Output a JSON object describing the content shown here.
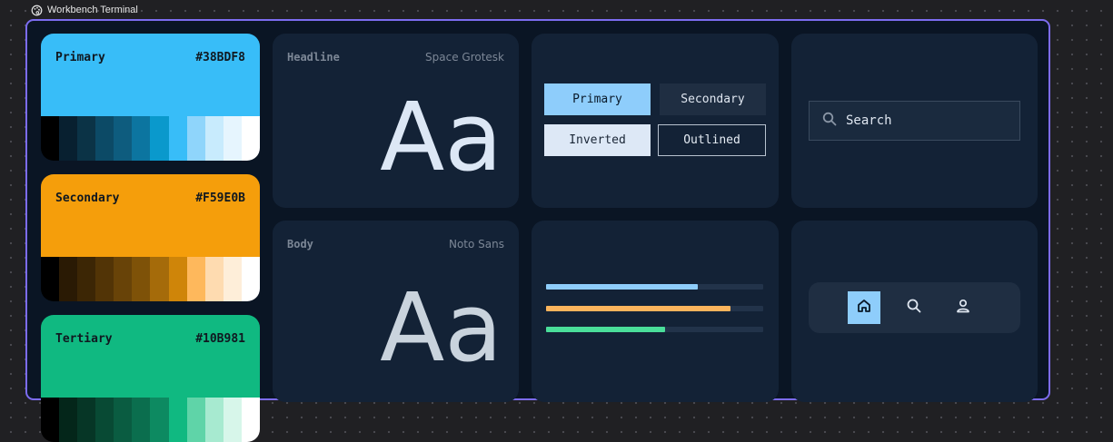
{
  "window": {
    "title": "Workbench Terminal"
  },
  "palettes": [
    {
      "name": "Primary",
      "hex": "#38BDF8",
      "color": "#38BDF8",
      "ramp": [
        "#000000",
        "#082030",
        "#0b3346",
        "#0c4a66",
        "#0e5c7e",
        "#0c75a0",
        "#0a99cc",
        "#38BDF8",
        "#8fd5fb",
        "#c8ebfd",
        "#e6f5fe",
        "#ffffff"
      ]
    },
    {
      "name": "Secondary",
      "hex": "#F59E0B",
      "color": "#F59E0B",
      "ramp": [
        "#000000",
        "#2a1a04",
        "#3c2605",
        "#523406",
        "#684308",
        "#7e5208",
        "#a56b0a",
        "#cf8509",
        "#feb85c",
        "#fedbb0",
        "#feeed9",
        "#ffffff"
      ]
    },
    {
      "name": "Tertiary",
      "hex": "#10B981",
      "color": "#10B981",
      "ramp": [
        "#000000",
        "#04261a",
        "#063626",
        "#084a34",
        "#0a5c41",
        "#0b6e4e",
        "#0d8a61",
        "#10B981",
        "#5fd4a8",
        "#a7ead0",
        "#d7f6ea",
        "#ffffff"
      ]
    }
  ],
  "typography": {
    "headline": {
      "label": "Headline",
      "font": "Space Grotesk",
      "sample": "Aa"
    },
    "body": {
      "label": "Body",
      "font": "Noto Sans",
      "sample": "Aa"
    }
  },
  "buttons": {
    "primary": "Primary",
    "secondary": "Secondary",
    "inverted": "Inverted",
    "outlined": "Outlined"
  },
  "search": {
    "placeholder": "Search",
    "icon": "search-icon"
  },
  "progress": [
    {
      "value": 0.7,
      "color": "#8ecdfb"
    },
    {
      "value": 0.85,
      "color": "#fbb45c"
    },
    {
      "value": 0.55,
      "color": "#4ade9a"
    }
  ],
  "nav": {
    "items": [
      {
        "icon": "home-icon",
        "active": true
      },
      {
        "icon": "search-icon",
        "active": false
      },
      {
        "icon": "user-icon",
        "active": false
      }
    ]
  },
  "colors": {
    "accent": "#7c6cf0",
    "card": "#132236",
    "frame_bg": "#0a1524",
    "active_nav": "#8ecdfb"
  }
}
